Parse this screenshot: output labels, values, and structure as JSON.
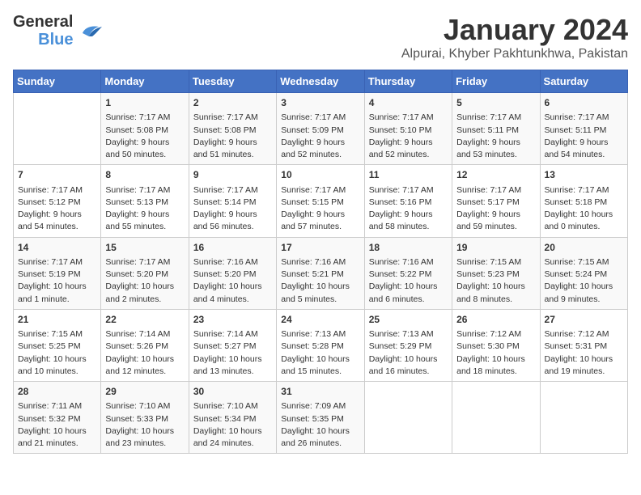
{
  "header": {
    "logo_general": "General",
    "logo_blue": "Blue",
    "month": "January 2024",
    "location": "Alpurai, Khyber Pakhtunkhwa, Pakistan"
  },
  "days_of_week": [
    "Sunday",
    "Monday",
    "Tuesday",
    "Wednesday",
    "Thursday",
    "Friday",
    "Saturday"
  ],
  "weeks": [
    [
      {
        "day": "",
        "info": ""
      },
      {
        "day": "1",
        "info": "Sunrise: 7:17 AM\nSunset: 5:08 PM\nDaylight: 9 hours\nand 50 minutes."
      },
      {
        "day": "2",
        "info": "Sunrise: 7:17 AM\nSunset: 5:08 PM\nDaylight: 9 hours\nand 51 minutes."
      },
      {
        "day": "3",
        "info": "Sunrise: 7:17 AM\nSunset: 5:09 PM\nDaylight: 9 hours\nand 52 minutes."
      },
      {
        "day": "4",
        "info": "Sunrise: 7:17 AM\nSunset: 5:10 PM\nDaylight: 9 hours\nand 52 minutes."
      },
      {
        "day": "5",
        "info": "Sunrise: 7:17 AM\nSunset: 5:11 PM\nDaylight: 9 hours\nand 53 minutes."
      },
      {
        "day": "6",
        "info": "Sunrise: 7:17 AM\nSunset: 5:11 PM\nDaylight: 9 hours\nand 54 minutes."
      }
    ],
    [
      {
        "day": "7",
        "info": "Sunrise: 7:17 AM\nSunset: 5:12 PM\nDaylight: 9 hours\nand 54 minutes."
      },
      {
        "day": "8",
        "info": "Sunrise: 7:17 AM\nSunset: 5:13 PM\nDaylight: 9 hours\nand 55 minutes."
      },
      {
        "day": "9",
        "info": "Sunrise: 7:17 AM\nSunset: 5:14 PM\nDaylight: 9 hours\nand 56 minutes."
      },
      {
        "day": "10",
        "info": "Sunrise: 7:17 AM\nSunset: 5:15 PM\nDaylight: 9 hours\nand 57 minutes."
      },
      {
        "day": "11",
        "info": "Sunrise: 7:17 AM\nSunset: 5:16 PM\nDaylight: 9 hours\nand 58 minutes."
      },
      {
        "day": "12",
        "info": "Sunrise: 7:17 AM\nSunset: 5:17 PM\nDaylight: 9 hours\nand 59 minutes."
      },
      {
        "day": "13",
        "info": "Sunrise: 7:17 AM\nSunset: 5:18 PM\nDaylight: 10 hours\nand 0 minutes."
      }
    ],
    [
      {
        "day": "14",
        "info": "Sunrise: 7:17 AM\nSunset: 5:19 PM\nDaylight: 10 hours\nand 1 minute."
      },
      {
        "day": "15",
        "info": "Sunrise: 7:17 AM\nSunset: 5:20 PM\nDaylight: 10 hours\nand 2 minutes."
      },
      {
        "day": "16",
        "info": "Sunrise: 7:16 AM\nSunset: 5:20 PM\nDaylight: 10 hours\nand 4 minutes."
      },
      {
        "day": "17",
        "info": "Sunrise: 7:16 AM\nSunset: 5:21 PM\nDaylight: 10 hours\nand 5 minutes."
      },
      {
        "day": "18",
        "info": "Sunrise: 7:16 AM\nSunset: 5:22 PM\nDaylight: 10 hours\nand 6 minutes."
      },
      {
        "day": "19",
        "info": "Sunrise: 7:15 AM\nSunset: 5:23 PM\nDaylight: 10 hours\nand 8 minutes."
      },
      {
        "day": "20",
        "info": "Sunrise: 7:15 AM\nSunset: 5:24 PM\nDaylight: 10 hours\nand 9 minutes."
      }
    ],
    [
      {
        "day": "21",
        "info": "Sunrise: 7:15 AM\nSunset: 5:25 PM\nDaylight: 10 hours\nand 10 minutes."
      },
      {
        "day": "22",
        "info": "Sunrise: 7:14 AM\nSunset: 5:26 PM\nDaylight: 10 hours\nand 12 minutes."
      },
      {
        "day": "23",
        "info": "Sunrise: 7:14 AM\nSunset: 5:27 PM\nDaylight: 10 hours\nand 13 minutes."
      },
      {
        "day": "24",
        "info": "Sunrise: 7:13 AM\nSunset: 5:28 PM\nDaylight: 10 hours\nand 15 minutes."
      },
      {
        "day": "25",
        "info": "Sunrise: 7:13 AM\nSunset: 5:29 PM\nDaylight: 10 hours\nand 16 minutes."
      },
      {
        "day": "26",
        "info": "Sunrise: 7:12 AM\nSunset: 5:30 PM\nDaylight: 10 hours\nand 18 minutes."
      },
      {
        "day": "27",
        "info": "Sunrise: 7:12 AM\nSunset: 5:31 PM\nDaylight: 10 hours\nand 19 minutes."
      }
    ],
    [
      {
        "day": "28",
        "info": "Sunrise: 7:11 AM\nSunset: 5:32 PM\nDaylight: 10 hours\nand 21 minutes."
      },
      {
        "day": "29",
        "info": "Sunrise: 7:10 AM\nSunset: 5:33 PM\nDaylight: 10 hours\nand 23 minutes."
      },
      {
        "day": "30",
        "info": "Sunrise: 7:10 AM\nSunset: 5:34 PM\nDaylight: 10 hours\nand 24 minutes."
      },
      {
        "day": "31",
        "info": "Sunrise: 7:09 AM\nSunset: 5:35 PM\nDaylight: 10 hours\nand 26 minutes."
      },
      {
        "day": "",
        "info": ""
      },
      {
        "day": "",
        "info": ""
      },
      {
        "day": "",
        "info": ""
      }
    ]
  ]
}
